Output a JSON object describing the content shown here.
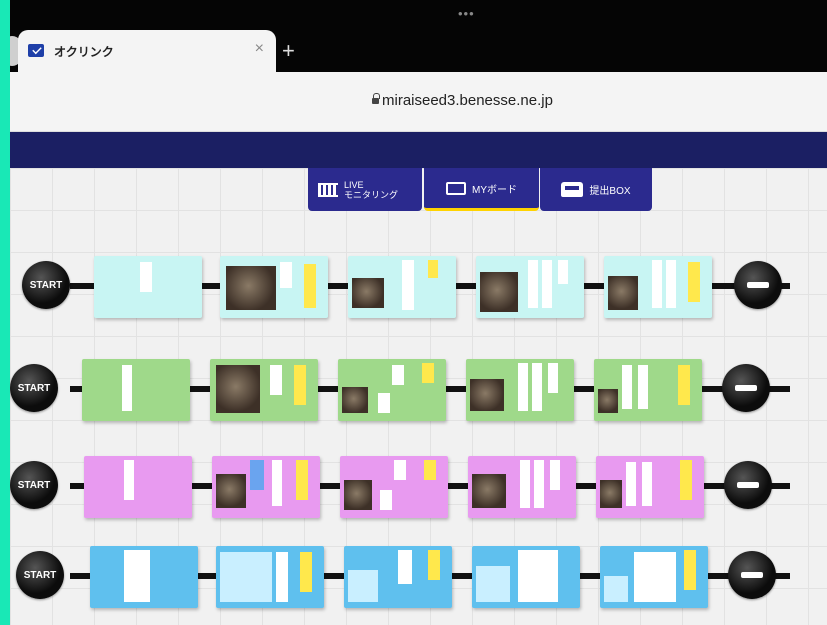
{
  "browser": {
    "tab_title": "オクリンク",
    "tab_close": "×",
    "new_tab": "+",
    "more": "•••",
    "url": "miraiseed3.benesse.ne.jp"
  },
  "nav": {
    "live_line1": "LIVE",
    "live_line2": "モニタリング",
    "myboard": "MYボード",
    "submit_box": "提出BOX"
  },
  "lanes": [
    {
      "start": "START",
      "color": "#c8f5f3",
      "cards": 5
    },
    {
      "start": "START",
      "color": "#9fd98a",
      "cards": 5
    },
    {
      "start": "START",
      "color": "#e89af0",
      "cards": 5
    },
    {
      "start": "START",
      "color": "#5fc0ee",
      "cards": 5
    }
  ],
  "colors": {
    "header": "#1b1f63",
    "nav_button": "#2b2a8e",
    "active_underline": "#ffd300",
    "frame": "#19e8b6"
  }
}
